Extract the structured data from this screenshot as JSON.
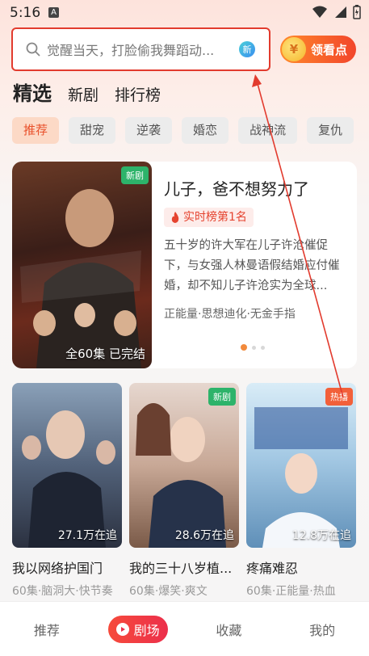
{
  "status_bar": {
    "time": "5:16",
    "notification": "A"
  },
  "search": {
    "placeholder": "觉醒当天，打脸偷我舞蹈动...",
    "badge": "新"
  },
  "coin_button": {
    "label": "领看点",
    "coin_glyph": "¥"
  },
  "top_tabs": [
    {
      "label": "精选",
      "active": true
    },
    {
      "label": "新剧",
      "active": false
    },
    {
      "label": "排行榜",
      "active": false
    }
  ],
  "chips": [
    {
      "label": "推荐",
      "active": true
    },
    {
      "label": "甜宠",
      "active": false
    },
    {
      "label": "逆袭",
      "active": false
    },
    {
      "label": "婚恋",
      "active": false
    },
    {
      "label": "战神流",
      "active": false
    },
    {
      "label": "复仇",
      "active": false
    }
  ],
  "featured": {
    "badge": "新剧",
    "episodes": "全60集  已完结",
    "title": "儿子，爸不想努力了",
    "rank": "实时榜第1名",
    "description": "五十岁的许大军在儿子许沧催促下，与女强人林曼语假结婚应付催婚，却不知儿子许沧实为全球...",
    "tags": "正能量·思想迪化·无金手指"
  },
  "grid": [
    {
      "title": "我以网络护国门",
      "views": "27.1万在追",
      "meta": "60集·脑洞大·快节奏",
      "badge": ""
    },
    {
      "title": "我的三十八岁植...",
      "views": "28.6万在追",
      "meta": "60集·爆笑·爽文",
      "badge": "新剧"
    },
    {
      "title": "疼痛难忍",
      "views": "12.8万在追",
      "meta": "60集·正能量·热血",
      "badge": "热播"
    }
  ],
  "bottom_nav": [
    {
      "label": "推荐",
      "active": false
    },
    {
      "label": "剧场",
      "active": true
    },
    {
      "label": "收藏",
      "active": false
    },
    {
      "label": "我的",
      "active": false
    }
  ],
  "colors": {
    "accent": "#f2452b",
    "annotation": "#e23b2e"
  }
}
